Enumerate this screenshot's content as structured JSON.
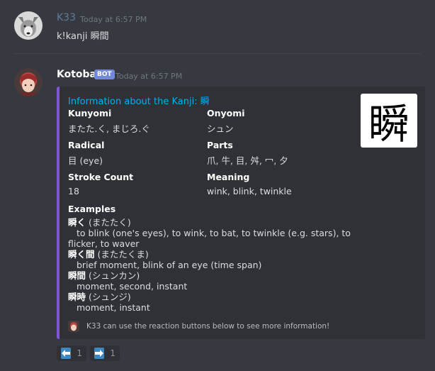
{
  "messages": [
    {
      "username": "K33",
      "timestamp": "Today at 6:57 PM",
      "content": "k!kanji 瞬間",
      "username_color": "#5e7a9a"
    },
    {
      "username": "Kotoba",
      "bot_tag": "BOT",
      "timestamp": "Today at 6:57 PM",
      "username_color": "#ffffff"
    }
  ],
  "embed": {
    "title": "Information about the Kanji: 瞬",
    "accent_color": "#7d55d6",
    "thumbnail_char": "瞬",
    "fields": [
      {
        "name": "Kunyomi",
        "value": "またた.く, まじろ.ぐ"
      },
      {
        "name": "Onyomi",
        "value": "シュン"
      },
      {
        "name": "Radical",
        "value": "目 (eye)"
      },
      {
        "name": "Parts",
        "value": "爪, 牛, 目, 舛, 冖, 夕"
      },
      {
        "name": "Stroke Count",
        "value": "18"
      },
      {
        "name": "Meaning",
        "value": "wink, blink, twinkle"
      }
    ],
    "examples_label": "Examples",
    "examples": [
      {
        "word": "瞬く",
        "reading": " (またたく)",
        "definition": "to blink (one's eyes), to wink, to bat, to twinkle (e.g. stars), to flicker, to waver"
      },
      {
        "word": "瞬く間",
        "reading": " (またたくま)",
        "definition": "brief moment, blink of an eye (time span)"
      },
      {
        "word": "瞬間",
        "reading": " (シュンカン)",
        "definition": "moment, second, instant"
      },
      {
        "word": "瞬時",
        "reading": " (シュンジ)",
        "definition": "moment, instant"
      }
    ],
    "footer_text": "K33 can use the reaction buttons below to see more information!"
  },
  "reactions": [
    {
      "icon": "arrow-left-icon",
      "glyph": "🡄",
      "count": "1"
    },
    {
      "icon": "arrow-right-icon",
      "glyph": "🡆",
      "count": "1"
    }
  ]
}
